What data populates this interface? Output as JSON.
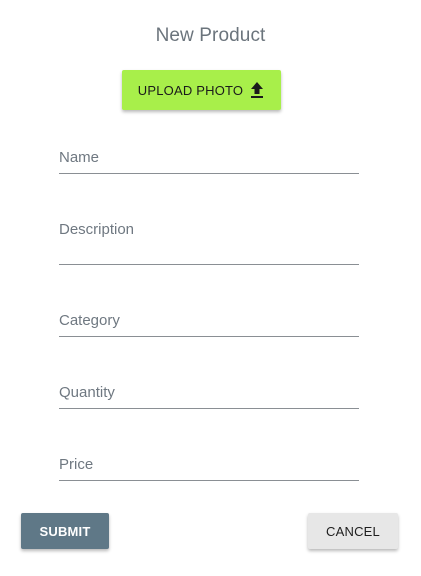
{
  "dialog": {
    "title": "New Product"
  },
  "upload": {
    "label": "UPLOAD PHOTO",
    "icon": "upload-icon",
    "color": "#a8ef4a"
  },
  "form": {
    "name": {
      "label": "Name",
      "value": ""
    },
    "description": {
      "label": "Description",
      "value": ""
    },
    "category": {
      "label": "Category",
      "value": ""
    },
    "quantity": {
      "label": "Quantity",
      "value": ""
    },
    "price": {
      "label": "Price",
      "value": ""
    }
  },
  "actions": {
    "submit_label": "SUBMIT",
    "submit_color": "#5f7887",
    "cancel_label": "CANCEL",
    "cancel_color": "#e7e7e7"
  }
}
